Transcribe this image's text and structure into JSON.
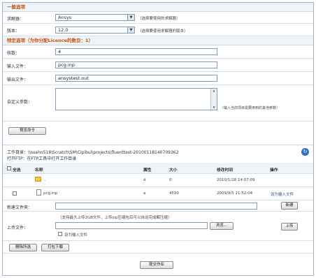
{
  "general": {
    "section_title": "一般选项",
    "solver_label": "求解器：",
    "solver_value": "Ansys",
    "solver_hint": "（选择要使用的求解器）",
    "version_label": "版本：",
    "version_value": "12.0",
    "version_hint": "（选择要使用求解器的版本）"
  },
  "specific": {
    "section_title": "特定选项（为你分配Licence的数目：1）",
    "cores_label": "核数：",
    "cores_value": "4",
    "input_label": "输入文件：",
    "input_value": "pcg.inp",
    "output_label": "输出文件：",
    "output_value": "ansystest.out",
    "custom_label": "自定义参数：",
    "custom_hint": "（输入当前项目需要用到的其他参数）",
    "preview_button": "预览命令"
  },
  "workdir": {
    "path_line": "工作目录：\\\\ssahn518\\Scratch\\SM\\Cipibul\\projects\\fluenttest-20100118140709362",
    "ftp_line": "打开FTP：在FTP工具中打开工作目录",
    "refresh_icon": "refresh-icon"
  },
  "files": {
    "headers": {
      "select_all": "全选",
      "name": "名称",
      "attr": "属性",
      "size": "大小",
      "mtime": "修改时间",
      "action": "操作"
    },
    "rows": [
      {
        "name": "..",
        "attr": "d",
        "size": "0",
        "mtime": "2010/1/18 14:07:09",
        "action": ""
      },
      {
        "name": "pcg.inp",
        "attr": "a",
        "size": "4590",
        "mtime": "2009/9/5 21:52:04",
        "action": "设为输入文件"
      }
    ]
  },
  "upload": {
    "new_folder_label": "新建文件夹：",
    "new_button": "新建",
    "upload_label": "上传文件：",
    "upload_hint": "（支持最大上传2GB文件，上传zip压缩包后可以自动完成解压缩）",
    "browse_button": "浏览...",
    "upload_button": "上传",
    "set_input_label": "设为输入文件",
    "delete_button": "删除所选",
    "download_button": "打包下载"
  },
  "submit_button": "提交作业"
}
